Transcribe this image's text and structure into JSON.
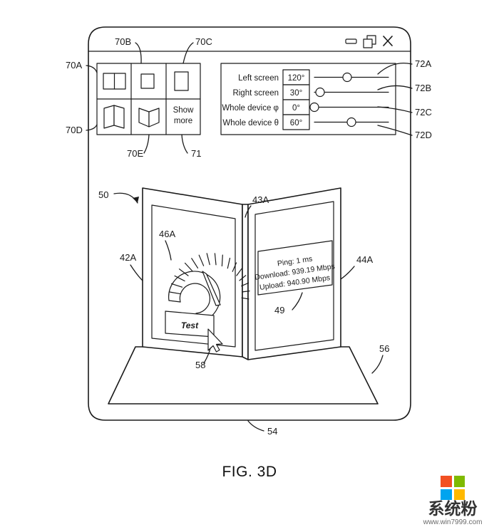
{
  "figure": {
    "caption": "FIG. 3D",
    "background": "#ffffff",
    "ink": "#1a1a1a"
  },
  "window": {
    "titlebar_controls": [
      {
        "name": "minimize-button",
        "glyph": "minimize"
      },
      {
        "name": "restore-button",
        "glyph": "restore"
      },
      {
        "name": "close-button",
        "glyph": "close"
      }
    ]
  },
  "posture_panel": {
    "ref_labels": {
      "left_top": "70A",
      "left_bottom": "70D",
      "top_left": "70B",
      "top_right": "70C",
      "bottom_left": "70E",
      "bottom_right": "71"
    },
    "cells": [
      {
        "name": "posture-dual-screen",
        "icon": "two-pane-flat-icon",
        "label": ""
      },
      {
        "name": "posture-single-screen-left",
        "icon": "single-pane-small-icon",
        "label": ""
      },
      {
        "name": "posture-single-screen-right",
        "icon": "single-pane-tall-icon",
        "label": ""
      },
      {
        "name": "posture-tent",
        "icon": "folded-tent-icon",
        "label": ""
      },
      {
        "name": "posture-book",
        "icon": "folded-book-icon",
        "label": ""
      },
      {
        "name": "show-more",
        "icon": "",
        "label": "Show more",
        "label_line1": "Show",
        "label_line2": "more"
      }
    ]
  },
  "slider_panel": {
    "ref_labels": [
      "72A",
      "72B",
      "72C",
      "72D"
    ],
    "rows": [
      {
        "name": "left-screen",
        "label": "Left screen",
        "value": "120°",
        "knob_pct": 44
      },
      {
        "name": "right-screen",
        "label": "Right screen",
        "value": "30°",
        "knob_pct": 8
      },
      {
        "name": "whole-device-phi",
        "label": "Whole device φ",
        "value": "0°",
        "knob_pct": 1
      },
      {
        "name": "whole-device-theta",
        "label": "Whole device θ",
        "value": "60°",
        "knob_pct": 50
      }
    ]
  },
  "device": {
    "ref_labels": {
      "device": "50",
      "left_screen": "42A",
      "hinge": "43A",
      "right_screen": "44A",
      "gauge": "46A",
      "results": "49",
      "cursor": "58",
      "base_right": "56",
      "base_front": "54"
    },
    "left_screen": {
      "gauge_name": "speed-gauge",
      "gauge_segments": 16,
      "button_label": "Test"
    },
    "right_screen": {
      "results": [
        "Ping: 1 ms",
        "Download: 939.19 Mbps",
        "Upload: 940.90 Mbps"
      ]
    }
  },
  "watermark": {
    "brand_cn": "系统粉",
    "url": "www.win7999.com",
    "colors": {
      "top_left": "#f25022",
      "top_right": "#7fba00",
      "bottom_left": "#00a4ef",
      "bottom_right": "#ffb900"
    }
  }
}
